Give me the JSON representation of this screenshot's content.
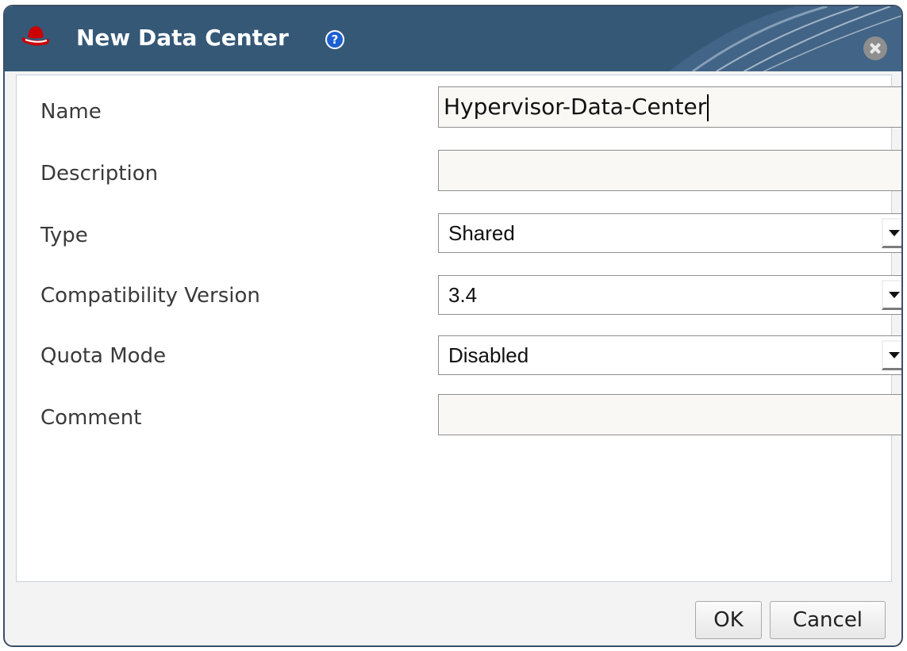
{
  "dialog": {
    "title": "New Data Center",
    "help_icon_label": "?",
    "icons": {
      "logo": "redhat-logo-icon",
      "help": "help-icon",
      "close": "close-icon"
    }
  },
  "fields": {
    "name": {
      "label": "Name",
      "value": "Hypervisor-Data-Center"
    },
    "description": {
      "label": "Description",
      "value": ""
    },
    "type": {
      "label": "Type",
      "value": "Shared"
    },
    "compatibility_version": {
      "label": "Compatibility Version",
      "value": "3.4"
    },
    "quota_mode": {
      "label": "Quota Mode",
      "value": "Disabled"
    },
    "comment": {
      "label": "Comment",
      "value": ""
    }
  },
  "buttons": {
    "ok": "OK",
    "cancel": "Cancel"
  },
  "colors": {
    "titlebar": "#355877",
    "help_badge": "#1d5fd1",
    "logo_red": "#cc0000"
  }
}
